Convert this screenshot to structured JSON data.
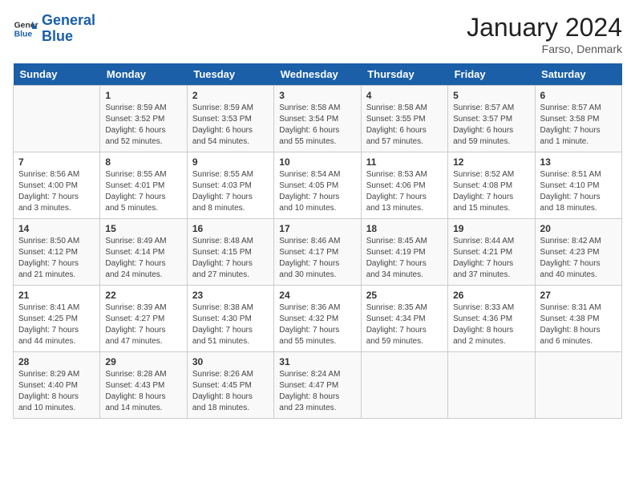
{
  "header": {
    "logo_line1": "General",
    "logo_line2": "Blue",
    "month_title": "January 2024",
    "location": "Farso, Denmark"
  },
  "weekdays": [
    "Sunday",
    "Monday",
    "Tuesday",
    "Wednesday",
    "Thursday",
    "Friday",
    "Saturday"
  ],
  "weeks": [
    [
      {
        "day": "",
        "info": ""
      },
      {
        "day": "1",
        "info": "Sunrise: 8:59 AM\nSunset: 3:52 PM\nDaylight: 6 hours\nand 52 minutes."
      },
      {
        "day": "2",
        "info": "Sunrise: 8:59 AM\nSunset: 3:53 PM\nDaylight: 6 hours\nand 54 minutes."
      },
      {
        "day": "3",
        "info": "Sunrise: 8:58 AM\nSunset: 3:54 PM\nDaylight: 6 hours\nand 55 minutes."
      },
      {
        "day": "4",
        "info": "Sunrise: 8:58 AM\nSunset: 3:55 PM\nDaylight: 6 hours\nand 57 minutes."
      },
      {
        "day": "5",
        "info": "Sunrise: 8:57 AM\nSunset: 3:57 PM\nDaylight: 6 hours\nand 59 minutes."
      },
      {
        "day": "6",
        "info": "Sunrise: 8:57 AM\nSunset: 3:58 PM\nDaylight: 7 hours\nand 1 minute."
      }
    ],
    [
      {
        "day": "7",
        "info": "Sunrise: 8:56 AM\nSunset: 4:00 PM\nDaylight: 7 hours\nand 3 minutes."
      },
      {
        "day": "8",
        "info": "Sunrise: 8:55 AM\nSunset: 4:01 PM\nDaylight: 7 hours\nand 5 minutes."
      },
      {
        "day": "9",
        "info": "Sunrise: 8:55 AM\nSunset: 4:03 PM\nDaylight: 7 hours\nand 8 minutes."
      },
      {
        "day": "10",
        "info": "Sunrise: 8:54 AM\nSunset: 4:05 PM\nDaylight: 7 hours\nand 10 minutes."
      },
      {
        "day": "11",
        "info": "Sunrise: 8:53 AM\nSunset: 4:06 PM\nDaylight: 7 hours\nand 13 minutes."
      },
      {
        "day": "12",
        "info": "Sunrise: 8:52 AM\nSunset: 4:08 PM\nDaylight: 7 hours\nand 15 minutes."
      },
      {
        "day": "13",
        "info": "Sunrise: 8:51 AM\nSunset: 4:10 PM\nDaylight: 7 hours\nand 18 minutes."
      }
    ],
    [
      {
        "day": "14",
        "info": "Sunrise: 8:50 AM\nSunset: 4:12 PM\nDaylight: 7 hours\nand 21 minutes."
      },
      {
        "day": "15",
        "info": "Sunrise: 8:49 AM\nSunset: 4:14 PM\nDaylight: 7 hours\nand 24 minutes."
      },
      {
        "day": "16",
        "info": "Sunrise: 8:48 AM\nSunset: 4:15 PM\nDaylight: 7 hours\nand 27 minutes."
      },
      {
        "day": "17",
        "info": "Sunrise: 8:46 AM\nSunset: 4:17 PM\nDaylight: 7 hours\nand 30 minutes."
      },
      {
        "day": "18",
        "info": "Sunrise: 8:45 AM\nSunset: 4:19 PM\nDaylight: 7 hours\nand 34 minutes."
      },
      {
        "day": "19",
        "info": "Sunrise: 8:44 AM\nSunset: 4:21 PM\nDaylight: 7 hours\nand 37 minutes."
      },
      {
        "day": "20",
        "info": "Sunrise: 8:42 AM\nSunset: 4:23 PM\nDaylight: 7 hours\nand 40 minutes."
      }
    ],
    [
      {
        "day": "21",
        "info": "Sunrise: 8:41 AM\nSunset: 4:25 PM\nDaylight: 7 hours\nand 44 minutes."
      },
      {
        "day": "22",
        "info": "Sunrise: 8:39 AM\nSunset: 4:27 PM\nDaylight: 7 hours\nand 47 minutes."
      },
      {
        "day": "23",
        "info": "Sunrise: 8:38 AM\nSunset: 4:30 PM\nDaylight: 7 hours\nand 51 minutes."
      },
      {
        "day": "24",
        "info": "Sunrise: 8:36 AM\nSunset: 4:32 PM\nDaylight: 7 hours\nand 55 minutes."
      },
      {
        "day": "25",
        "info": "Sunrise: 8:35 AM\nSunset: 4:34 PM\nDaylight: 7 hours\nand 59 minutes."
      },
      {
        "day": "26",
        "info": "Sunrise: 8:33 AM\nSunset: 4:36 PM\nDaylight: 8 hours\nand 2 minutes."
      },
      {
        "day": "27",
        "info": "Sunrise: 8:31 AM\nSunset: 4:38 PM\nDaylight: 8 hours\nand 6 minutes."
      }
    ],
    [
      {
        "day": "28",
        "info": "Sunrise: 8:29 AM\nSunset: 4:40 PM\nDaylight: 8 hours\nand 10 minutes."
      },
      {
        "day": "29",
        "info": "Sunrise: 8:28 AM\nSunset: 4:43 PM\nDaylight: 8 hours\nand 14 minutes."
      },
      {
        "day": "30",
        "info": "Sunrise: 8:26 AM\nSunset: 4:45 PM\nDaylight: 8 hours\nand 18 minutes."
      },
      {
        "day": "31",
        "info": "Sunrise: 8:24 AM\nSunset: 4:47 PM\nDaylight: 8 hours\nand 23 minutes."
      },
      {
        "day": "",
        "info": ""
      },
      {
        "day": "",
        "info": ""
      },
      {
        "day": "",
        "info": ""
      }
    ]
  ]
}
